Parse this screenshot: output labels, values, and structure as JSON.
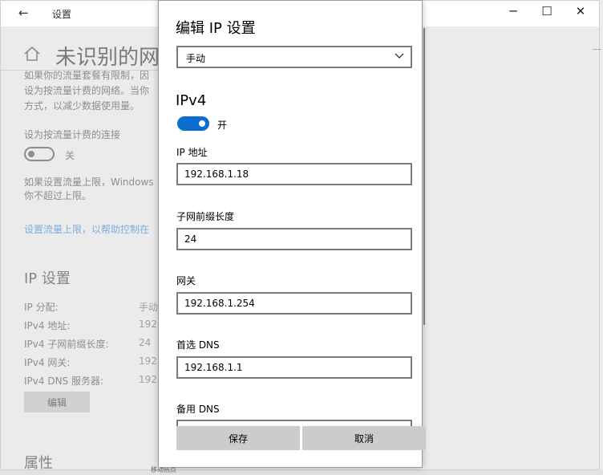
{
  "window": {
    "back_glyph": "←",
    "title": "设置",
    "minimize_glyph": "─",
    "maximize_glyph": "☐",
    "close_glyph": "✕"
  },
  "page": {
    "title": "未识别的网",
    "metered_desc": "如果你的流量套餐有限制，因\n设为按流量计费的网络。当你\n方式，以减少数据使用量。",
    "metered_label": "设为按流量计费的连接",
    "metered_toggle_state": "关",
    "limit_desc": "如果设置流量上限，Windows\n你不超过上限。",
    "limit_link": "设置流量上限，以帮助控制在",
    "ip_heading": "IP 设置",
    "ip_rows": [
      {
        "label": "IP 分配:",
        "value": "手动"
      },
      {
        "label": "IPv4 地址:",
        "value": "192."
      },
      {
        "label": "IPv4 子网前缀长度:",
        "value": "24"
      },
      {
        "label": "IPv4 网关:",
        "value": "192."
      },
      {
        "label": "IPv4 DNS 服务器:",
        "value": "192."
      }
    ],
    "edit_label": "编辑",
    "props_heading": "属性",
    "bottom_snippet": "移动热点"
  },
  "dialog": {
    "title": "编辑 IP 设置",
    "mode_value": "手动",
    "section": "IPv4",
    "ipv4_toggle_state": "开",
    "fields": [
      {
        "label": "IP 地址",
        "value": "192.168.1.18"
      },
      {
        "label": "子网前缀长度",
        "value": "24"
      },
      {
        "label": "网关",
        "value": "192.168.1.254"
      },
      {
        "label": "首选 DNS",
        "value": "192.168.1.1"
      },
      {
        "label": "备用 DNS",
        "value": ""
      }
    ],
    "save_label": "保存",
    "cancel_label": "取消"
  },
  "colors": {
    "accent": "#0a6ed1",
    "link": "#3a8ee0"
  }
}
